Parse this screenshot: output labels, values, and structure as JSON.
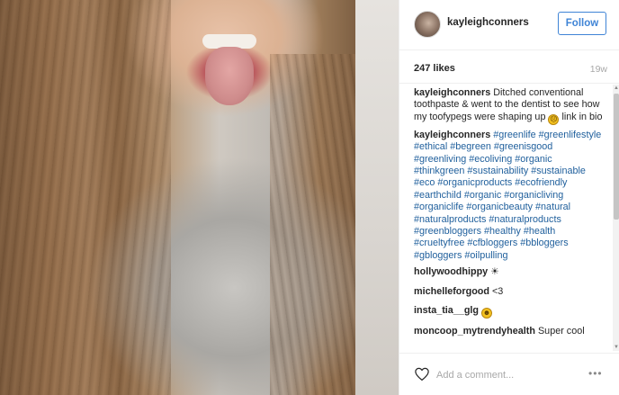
{
  "post": {
    "username": "kayleighconners",
    "follow_label": "Follow",
    "likes": "247 likes",
    "age": "19w"
  },
  "comments": [
    {
      "author": "kayleighconners",
      "text": "Ditched conventional toothpaste & went to the dentist to see how my toofypegs were shaping up",
      "emoji": "☹",
      "text_after": "link in bio"
    },
    {
      "author": "kayleighconners",
      "tags": "#greenlife #greenlifestyle #ethical #begreen #greenisgood #greenliving #ecoliving #organic #thinkgreen #sustainability #sustainable #eco #organicproducts #ecofriendly #earthchild #organic #organicliving #organiclife #organicbeauty #natural #naturalproducts #naturalproducts #greenbloggers #healthy #health #crueltyfree #cfbloggers #bbloggers #gbloggers #oilpulling"
    },
    {
      "author": "hollywoodhippy",
      "text": "☀"
    },
    {
      "author": "michelleforgood",
      "text": "<3"
    },
    {
      "author": "insta_tia__glg",
      "emoji": "☻"
    },
    {
      "author": "moncoop_mytrendyhealth",
      "text": "Super cool"
    }
  ],
  "footer": {
    "comment_placeholder": "Add a comment...",
    "more_label": "•••"
  },
  "icons": {
    "heart": "heart-outline-icon",
    "more": "more-options-icon"
  },
  "colors": {
    "accent": "#3f84d6",
    "hashtag": "#1f5f9c",
    "muted": "#a8a8a8"
  }
}
